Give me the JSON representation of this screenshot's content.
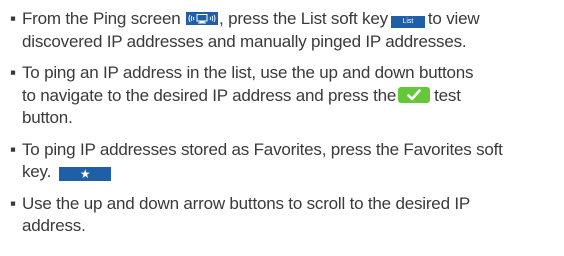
{
  "bullet": "▪",
  "items": [
    {
      "l1a": "From the Ping screen",
      "l1b": ", press the List soft key",
      "l1c": "to view",
      "l2": "discovered IP addresses and manually pinged IP addresses."
    },
    {
      "l1": "To ping an IP address in the list, use the up and down buttons",
      "l2a": "to navigate to the desired IP address and press the",
      "l2b": "test",
      "l3": "button."
    },
    {
      "l1": "To ping IP addresses stored as Favorites, press the Favorites soft",
      "l2": "key."
    },
    {
      "l1": "Use the up and down arrow buttons to scroll to the desired IP",
      "l2": "address."
    }
  ],
  "icons": {
    "ping_key": "ping-key-icon",
    "list_key_label": "List",
    "test_key": "checkmark-icon",
    "favorites_key_glyph": "★"
  },
  "colors": {
    "text": "#3a3a3a",
    "key_blue": "#1f5fa8",
    "test_green": "#64c83a"
  }
}
